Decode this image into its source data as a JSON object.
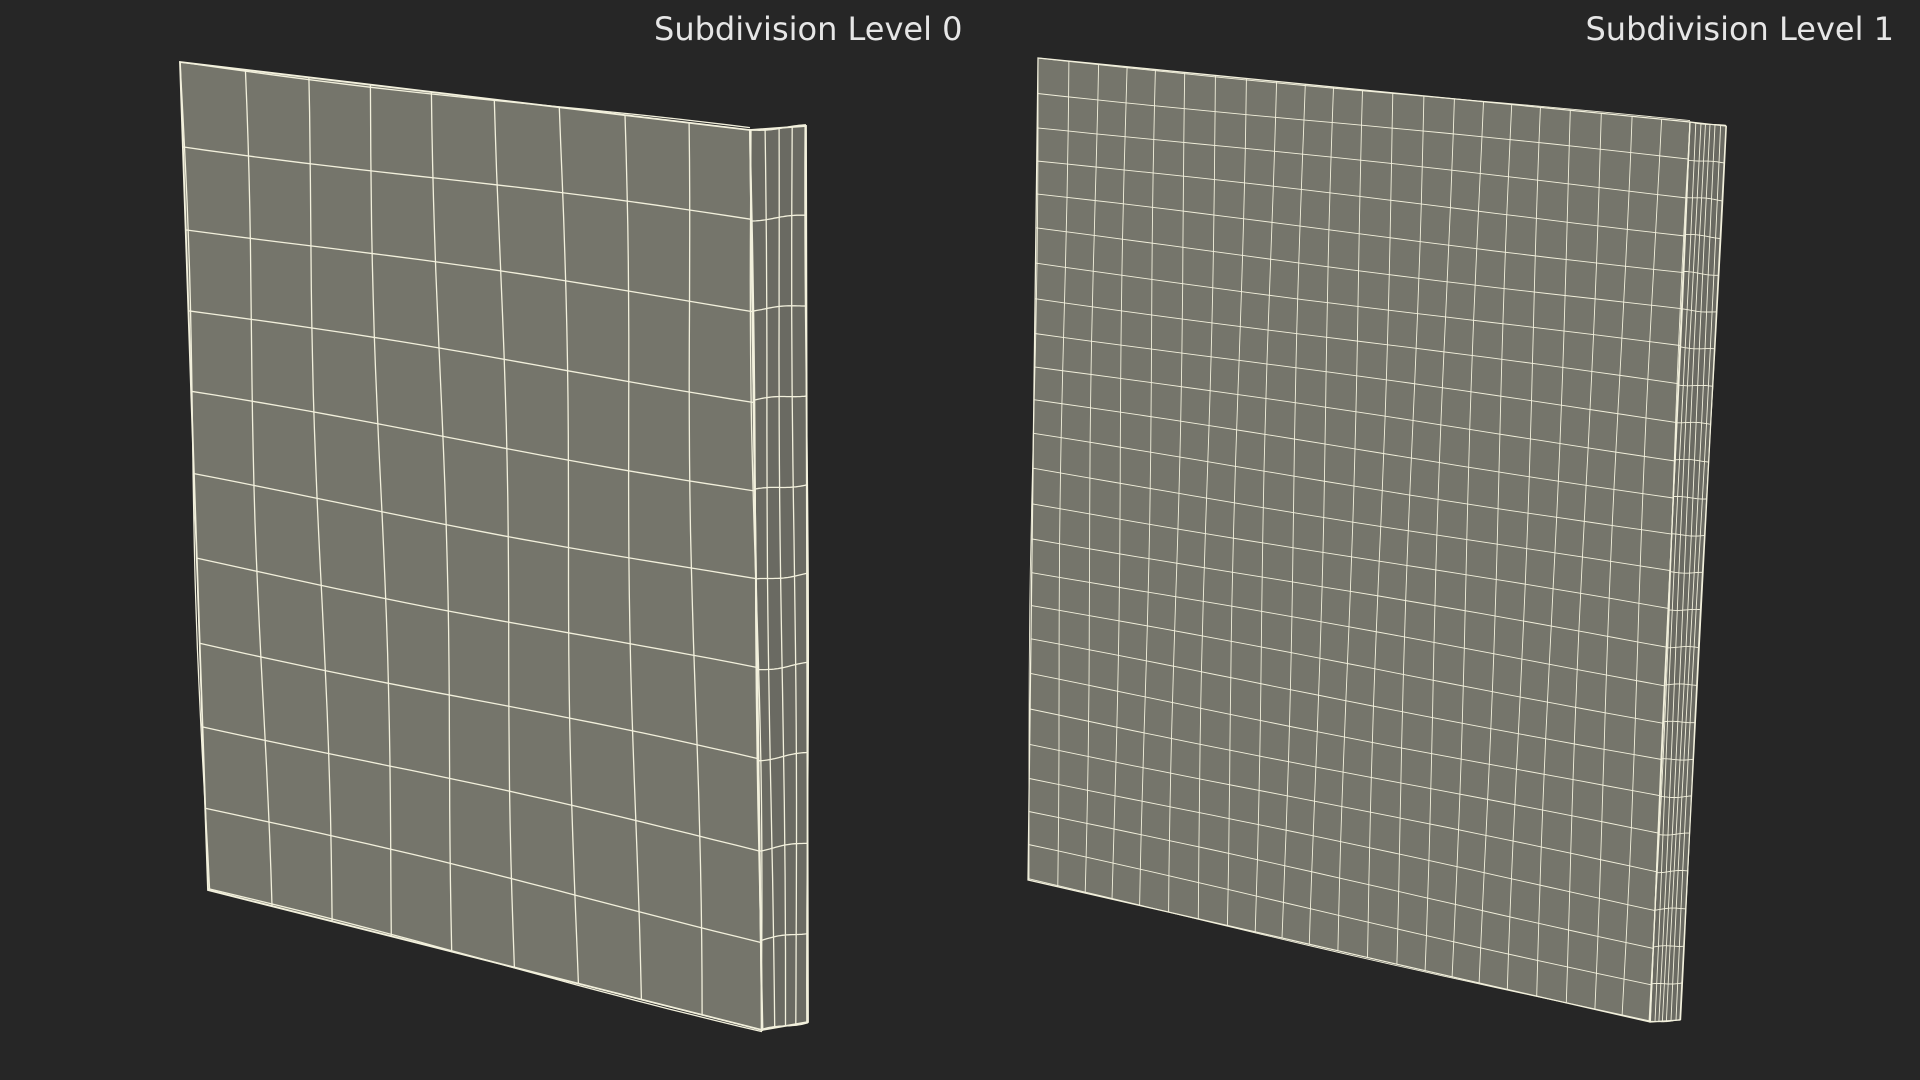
{
  "labels": {
    "left": "Subdivision Level 0",
    "right": "Subdivision Level 1"
  },
  "colors": {
    "background": "#262626",
    "face_fill": "#75756b",
    "side_fill": "#6a6a62",
    "wire": "#f2f0dc",
    "label_text": "#e6e6e6"
  },
  "meshes": [
    {
      "name": "level-0",
      "cols": 9,
      "rows": 10
    },
    {
      "name": "level-1",
      "cols": 22,
      "rows": 24
    }
  ]
}
